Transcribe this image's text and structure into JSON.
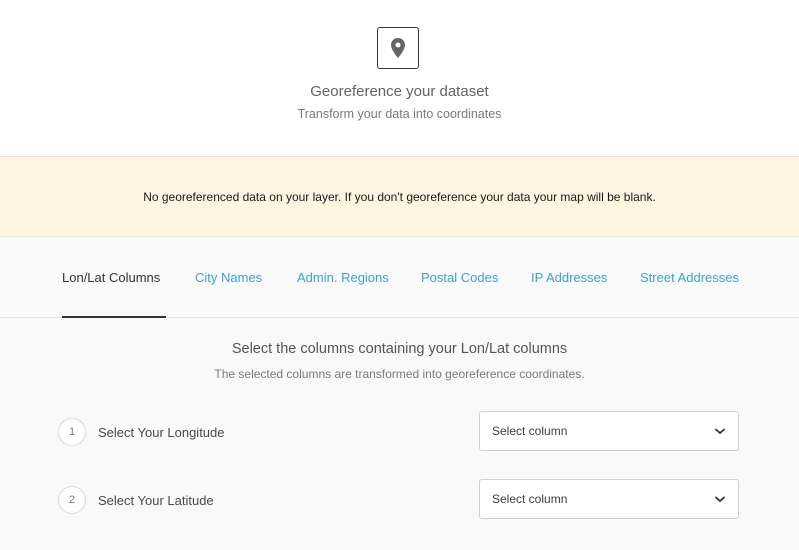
{
  "header": {
    "title": "Georeference your dataset",
    "subtitle": "Transform your data into coordinates",
    "icon": "map-pin-icon"
  },
  "warning": {
    "text": "No georeferenced data on your layer. If you don't georeference your data your map will be blank."
  },
  "tabs": [
    {
      "label": "Lon/Lat Columns",
      "active": true
    },
    {
      "label": "City Names",
      "active": false
    },
    {
      "label": "Admin. Regions",
      "active": false
    },
    {
      "label": "Postal Codes",
      "active": false
    },
    {
      "label": "IP Addresses",
      "active": false
    },
    {
      "label": "Street Addresses",
      "active": false
    }
  ],
  "section": {
    "title": "Select the columns containing your Lon/Lat columns",
    "subtitle": "The selected columns are transformed into georeference coordinates."
  },
  "steps": [
    {
      "number": "1",
      "label": "Select Your Longitude",
      "select_value": "Select column"
    },
    {
      "number": "2",
      "label": "Select Your Latitude",
      "select_value": "Select column"
    }
  ],
  "colors": {
    "accent": "#3aa3d6",
    "warning_bg": "#fdf5e0"
  }
}
